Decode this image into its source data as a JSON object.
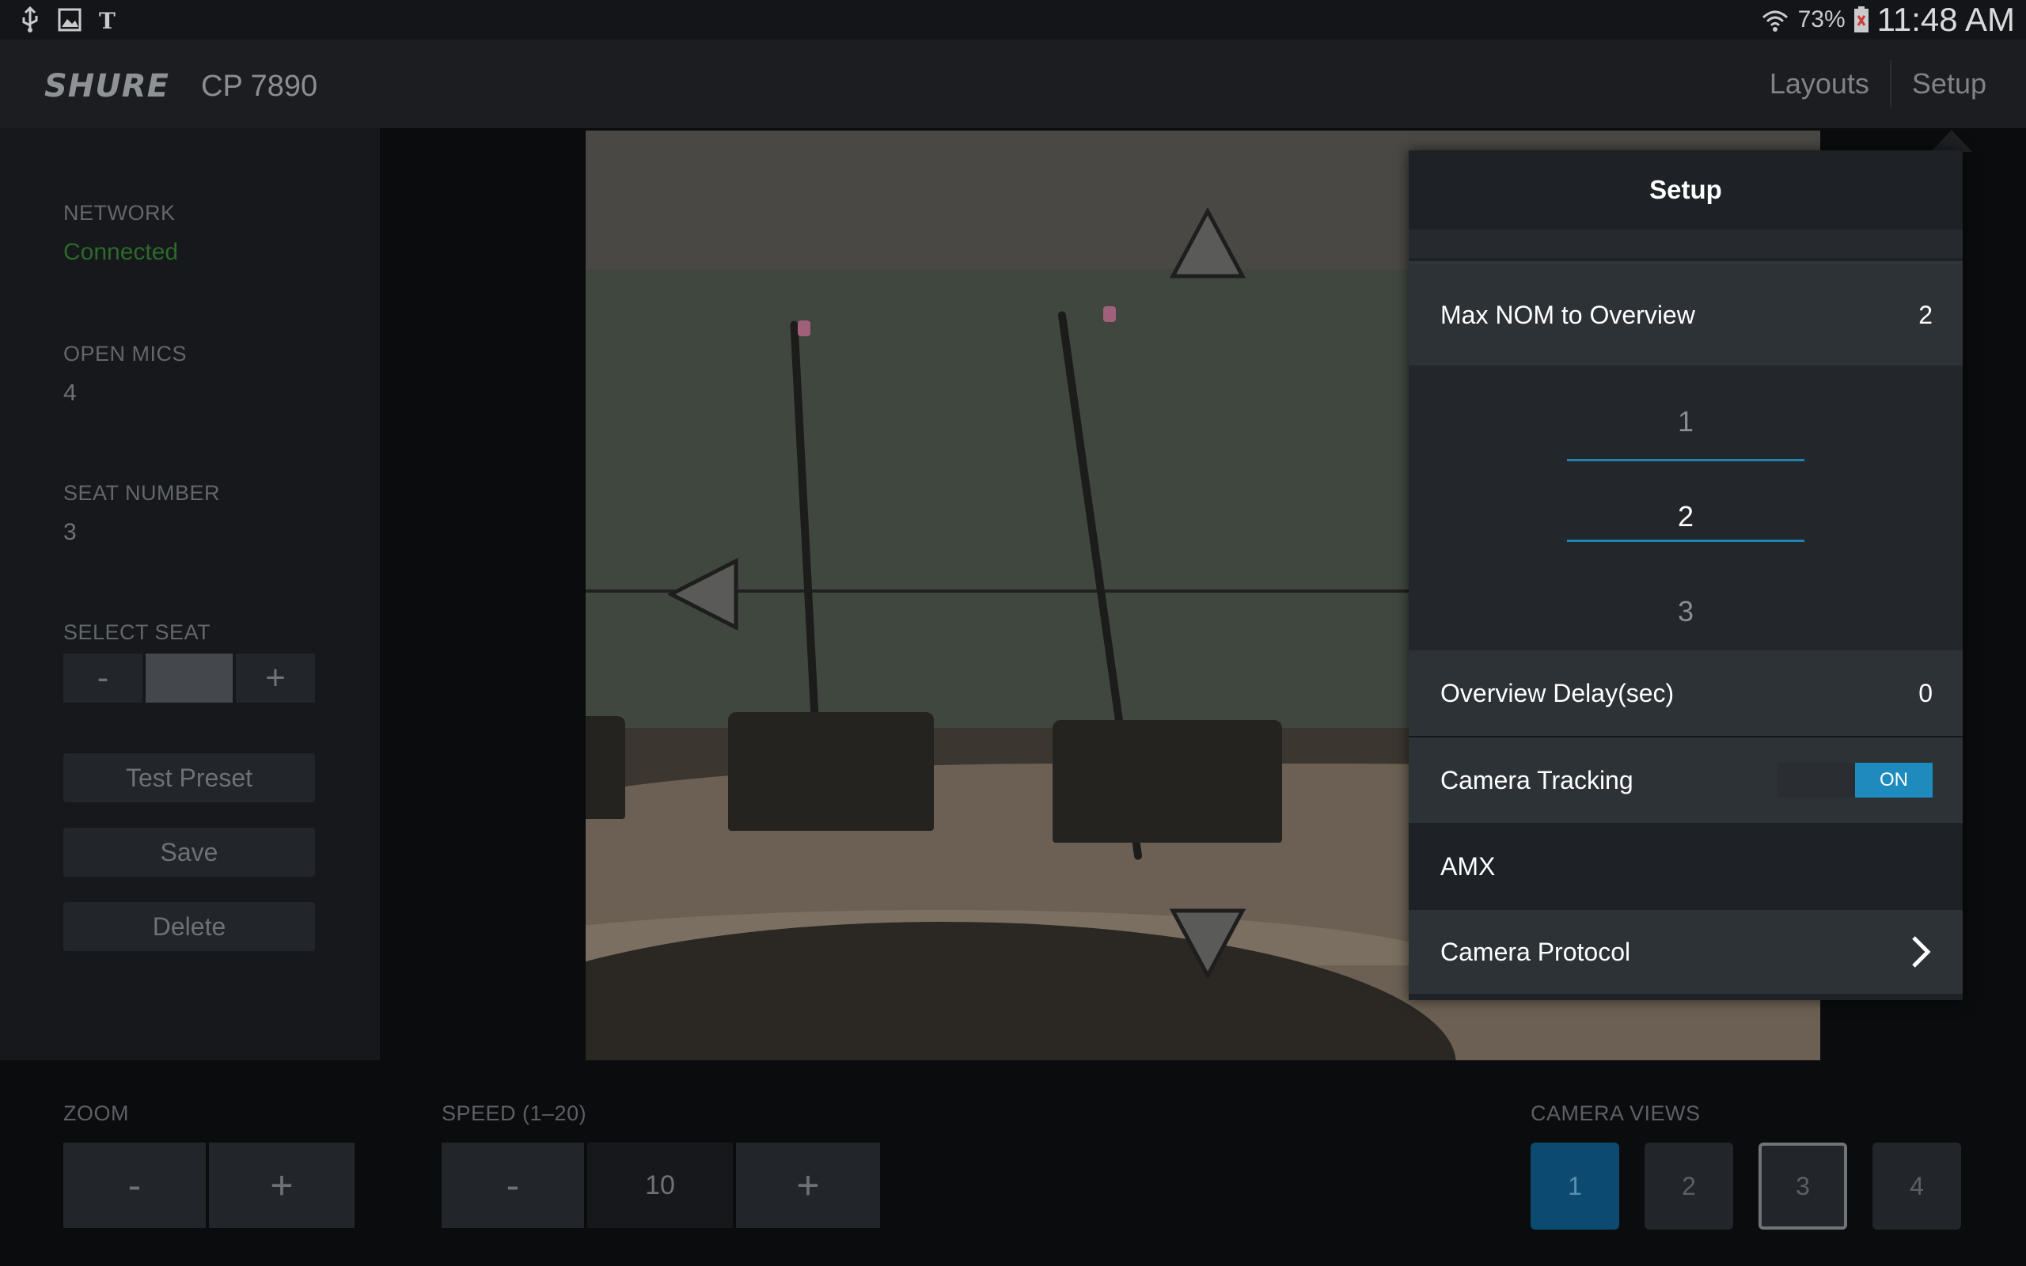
{
  "status_bar": {
    "battery_percent": "73%",
    "time": "11:48 AM",
    "icons": [
      "usb-icon",
      "image-icon",
      "news-icon",
      "wifi-icon",
      "battery-icon"
    ]
  },
  "header": {
    "brand": "SHURE",
    "model": "CP 7890",
    "nav": {
      "layouts": "Layouts",
      "setup": "Setup"
    }
  },
  "sidebar": {
    "network_label": "NETWORK",
    "network_value": "Connected",
    "open_mics_label": "OPEN MICS",
    "open_mics_value": "4",
    "seat_number_label": "SEAT NUMBER",
    "seat_number_value": "3",
    "select_seat_label": "SELECT SEAT",
    "minus": "-",
    "plus": "+",
    "test_preset": "Test Preset",
    "save": "Save",
    "delete": "Delete"
  },
  "bottom": {
    "zoom_label": "ZOOM",
    "zoom_minus": "-",
    "zoom_plus": "+",
    "speed_label": "SPEED (1–20)",
    "speed_minus": "-",
    "speed_value": "10",
    "speed_plus": "+",
    "camera_views_label": "CAMERA VIEWS",
    "camera_views": [
      "1",
      "2",
      "3",
      "4"
    ]
  },
  "setup": {
    "title": "Setup",
    "max_nom_label": "Max NOM to Overview",
    "max_nom_value": "2",
    "picker": [
      "1",
      "2",
      "3"
    ],
    "overview_delay_label": "Overview Delay(sec)",
    "overview_delay_value": "0",
    "camera_tracking_label": "Camera Tracking",
    "camera_tracking_state": "ON",
    "amx_label": "AMX",
    "camera_protocol_label": "Camera Protocol"
  },
  "colors": {
    "accent": "#1e8bbf",
    "connected": "#2b6a2b",
    "active_view": "#0d4a72"
  }
}
